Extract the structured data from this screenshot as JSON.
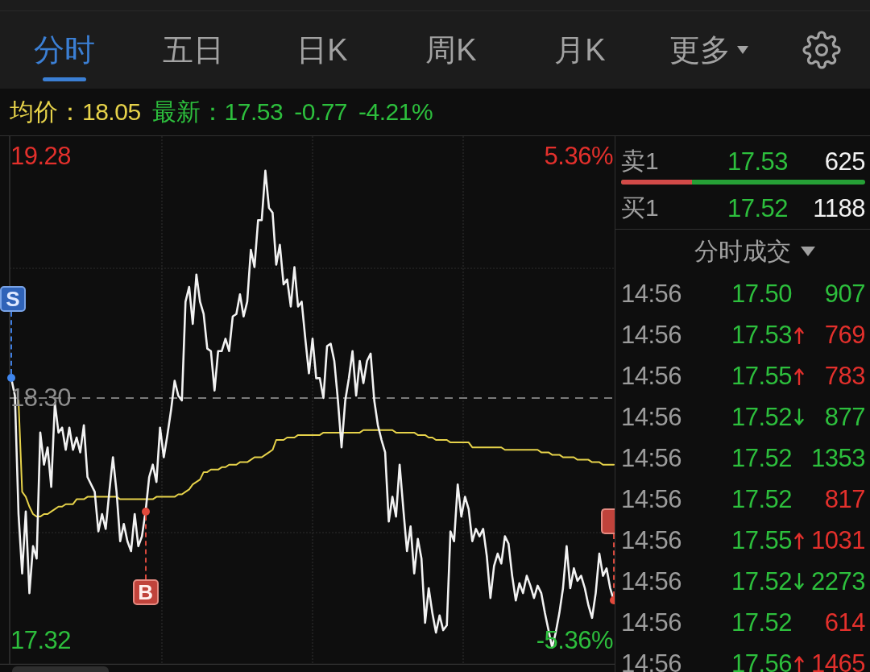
{
  "tabs": [
    {
      "label": "分时",
      "selected": true,
      "kind": "tab"
    },
    {
      "label": "五日",
      "selected": false,
      "kind": "tab"
    },
    {
      "label": "日K",
      "selected": false,
      "kind": "tab"
    },
    {
      "label": "周K",
      "selected": false,
      "kind": "tab"
    },
    {
      "label": "月K",
      "selected": false,
      "kind": "tab"
    },
    {
      "label": "更多",
      "selected": false,
      "kind": "dropdown"
    }
  ],
  "quote": [
    {
      "label": "均价：",
      "value": "18.05",
      "color": "#e6d24a"
    },
    {
      "label": "最新：",
      "value": "17.53",
      "color": "#2dbf3d"
    },
    {
      "value": "-0.77",
      "color": "#2dbf3d"
    },
    {
      "value": "-4.21%",
      "color": "#2dbf3d"
    }
  ],
  "chart": {
    "chart_data": {
      "type": "line",
      "categories": [
        null,
        null,
        null,
        null,
        null,
        null,
        null,
        null,
        null,
        null,
        null,
        null,
        null,
        null,
        null,
        null,
        null,
        null,
        null,
        null,
        null,
        null,
        null,
        null,
        null,
        null,
        null,
        null,
        null,
        null,
        null,
        null,
        null,
        null,
        null,
        null,
        null,
        null,
        null,
        null,
        null,
        null,
        null,
        null,
        null,
        null,
        null,
        null,
        null,
        null,
        null,
        null,
        null,
        null,
        null,
        null,
        null,
        null,
        null,
        null,
        null,
        null,
        null,
        null,
        null,
        null,
        null,
        null,
        null,
        null,
        null,
        null,
        null,
        null,
        null,
        null,
        null,
        null,
        null,
        null,
        null,
        null,
        null,
        null,
        null,
        null,
        null,
        null,
        null,
        null,
        null,
        null,
        null,
        null,
        null,
        null,
        null,
        null,
        null,
        null,
        null,
        null,
        null,
        null,
        null,
        null,
        null,
        null,
        null,
        null,
        null,
        null,
        null,
        null,
        null,
        null,
        null,
        null,
        null,
        null,
        null,
        null,
        null,
        null,
        null,
        null,
        null,
        null,
        null,
        null,
        null,
        null,
        null,
        null,
        null,
        null,
        null,
        null,
        null,
        null,
        null,
        null,
        null,
        null,
        null,
        null,
        null,
        null,
        null,
        null,
        null,
        null,
        null,
        null,
        null,
        null,
        null,
        null,
        null,
        null,
        null,
        null,
        null,
        null,
        null,
        null,
        null
      ],
      "series": [
        {
          "color": "#f2f2f2",
          "values": [
            18.38,
            18.31,
            17.83,
            17.59,
            17.84,
            17.51,
            17.7,
            17.65,
            18.16,
            18.03,
            18.1,
            17.94,
            18.28,
            18.16,
            18.18,
            18.09,
            18.18,
            18.09,
            18.14,
            18.08,
            18.19,
            17.98,
            17.95,
            17.92,
            17.76,
            17.83,
            17.77,
            17.92,
            18.06,
            17.92,
            17.72,
            17.79,
            17.72,
            17.68,
            17.83,
            17.7,
            17.74,
            17.84,
            17.98,
            18.03,
            17.96,
            18.18,
            18.06,
            18.15,
            18.25,
            18.37,
            18.31,
            18.29,
            18.69,
            18.75,
            18.6,
            18.8,
            18.69,
            18.64,
            18.5,
            18.49,
            18.33,
            18.49,
            18.49,
            18.54,
            18.49,
            18.63,
            18.64,
            18.72,
            18.63,
            18.69,
            18.9,
            18.83,
            19.02,
            19.02,
            19.22,
            19.07,
            19.05,
            18.84,
            18.92,
            18.76,
            18.78,
            18.67,
            18.83,
            18.67,
            18.69,
            18.54,
            18.4,
            18.54,
            18.38,
            18.38,
            18.3,
            18.51,
            18.52,
            18.45,
            18.29,
            18.1,
            18.29,
            18.38,
            18.49,
            18.31,
            18.45,
            18.36,
            18.45,
            18.48,
            18.29,
            18.19,
            18.13,
            18.08,
            17.8,
            17.9,
            17.82,
            18.03,
            17.85,
            17.68,
            17.78,
            17.59,
            17.73,
            17.65,
            17.39,
            17.53,
            17.43,
            17.35,
            17.42,
            17.36,
            17.38,
            17.76,
            17.72,
            17.95,
            17.82,
            17.9,
            17.85,
            17.72,
            17.77,
            17.74,
            17.77,
            17.66,
            17.49,
            17.62,
            17.67,
            17.63,
            17.74,
            17.71,
            17.58,
            17.48,
            17.55,
            17.51,
            17.58,
            17.54,
            17.49,
            17.54,
            17.51,
            17.43,
            17.36,
            17.29,
            17.35,
            17.43,
            17.53,
            17.7,
            17.53,
            17.61,
            17.56,
            17.58,
            17.53,
            17.46,
            17.41,
            17.51,
            17.67,
            17.58,
            17.61,
            17.53,
            17.48
          ]
        },
        {
          "color": "#e6d24a",
          "values": [
            null,
            null,
            18.29,
            17.92,
            17.9,
            17.86,
            17.83,
            17.82,
            17.82,
            17.83,
            17.83,
            17.84,
            17.85,
            17.86,
            17.86,
            17.87,
            17.87,
            17.87,
            17.89,
            17.89,
            17.89,
            17.9,
            17.9,
            17.9,
            17.9,
            17.9,
            17.9,
            17.9,
            17.9,
            17.9,
            17.89,
            17.89,
            17.89,
            17.89,
            17.89,
            17.89,
            17.89,
            17.89,
            17.89,
            17.89,
            17.9,
            17.9,
            17.9,
            17.9,
            17.9,
            17.9,
            17.91,
            17.91,
            17.92,
            17.93,
            17.95,
            17.96,
            17.97,
            18.0,
            18.0,
            18.01,
            18.01,
            18.01,
            18.02,
            18.02,
            18.03,
            18.03,
            18.03,
            18.04,
            18.04,
            18.04,
            18.05,
            18.06,
            18.06,
            18.06,
            18.07,
            18.08,
            18.09,
            18.13,
            18.13,
            18.13,
            18.14,
            18.14,
            18.14,
            18.15,
            18.15,
            18.15,
            18.15,
            18.15,
            18.15,
            18.15,
            18.16,
            18.16,
            18.16,
            18.16,
            18.16,
            18.16,
            18.16,
            18.16,
            18.16,
            18.16,
            18.16,
            18.17,
            18.17,
            18.17,
            18.17,
            18.17,
            18.17,
            18.17,
            18.17,
            18.17,
            18.16,
            18.16,
            18.16,
            18.16,
            18.16,
            18.16,
            18.15,
            18.15,
            18.15,
            18.14,
            18.14,
            18.13,
            18.13,
            18.13,
            18.13,
            18.12,
            18.12,
            18.12,
            18.12,
            18.12,
            18.12,
            18.1,
            18.1,
            18.1,
            18.1,
            18.1,
            18.1,
            18.1,
            18.1,
            18.1,
            18.09,
            18.09,
            18.09,
            18.09,
            18.09,
            18.09,
            18.09,
            18.09,
            18.09,
            18.09,
            18.08,
            18.08,
            18.08,
            18.07,
            18.07,
            18.07,
            18.06,
            18.06,
            18.06,
            18.06,
            18.05,
            18.05,
            18.05,
            18.05,
            18.04,
            18.04,
            18.04,
            18.03,
            18.03,
            18.03,
            18.03
          ]
        }
      ],
      "ylim": [
        17.22,
        19.36
      ],
      "yticks": [
        {
          "value": 19.28,
          "label": "19.28"
        },
        {
          "value": 18.3,
          "label": "18.30"
        },
        {
          "value": 17.32,
          "label": "17.32"
        }
      ],
      "ref_lines": [
        {
          "axis": "y",
          "value": 18.3
        }
      ]
    },
    "percent_labels": [
      "5.36%",
      "-5.36%"
    ],
    "trade_markers": [
      {
        "kind": "sell",
        "label": "S",
        "below": false
      },
      {
        "kind": "buy",
        "label": "B",
        "below": true
      },
      {
        "kind": "buy",
        "below": false
      }
    ]
  },
  "order_book": {
    "rows": [
      {
        "label": "卖1",
        "price": "17.53",
        "volume": "625"
      },
      {
        "label": "买1",
        "price": "17.52",
        "volume": "1188"
      }
    ],
    "bar": {
      "level": 0.29
    }
  },
  "trades": {
    "header": "分时成交",
    "rows": [
      {
        "time": "14:56",
        "price": "17.50",
        "kind": "flat",
        "volume": "907",
        "color": "#2dbf3d"
      },
      {
        "time": "14:56",
        "price": "17.53",
        "kind": "up",
        "volume": "769",
        "color": "#e3302c"
      },
      {
        "time": "14:56",
        "price": "17.55",
        "kind": "up",
        "volume": "783",
        "color": "#e3302c"
      },
      {
        "time": "14:56",
        "price": "17.52",
        "kind": "down",
        "volume": "877",
        "color": "#2dbf3d"
      },
      {
        "time": "14:56",
        "price": "17.52",
        "kind": "flat",
        "volume": "1353",
        "color": "#2dbf3d"
      },
      {
        "time": "14:56",
        "price": "17.52",
        "kind": "flat",
        "volume": "817",
        "color": "#e3302c"
      },
      {
        "time": "14:56",
        "price": "17.55",
        "kind": "up",
        "volume": "1031",
        "color": "#e3302c"
      },
      {
        "time": "14:56",
        "price": "17.52",
        "kind": "down",
        "volume": "2273",
        "color": "#2dbf3d"
      },
      {
        "time": "14:56",
        "price": "17.52",
        "kind": "flat",
        "volume": "614",
        "color": "#e3302c"
      },
      {
        "time": "14:56",
        "price": "17.56",
        "kind": "up",
        "volume": "1465",
        "color": "#e3302c"
      }
    ]
  }
}
